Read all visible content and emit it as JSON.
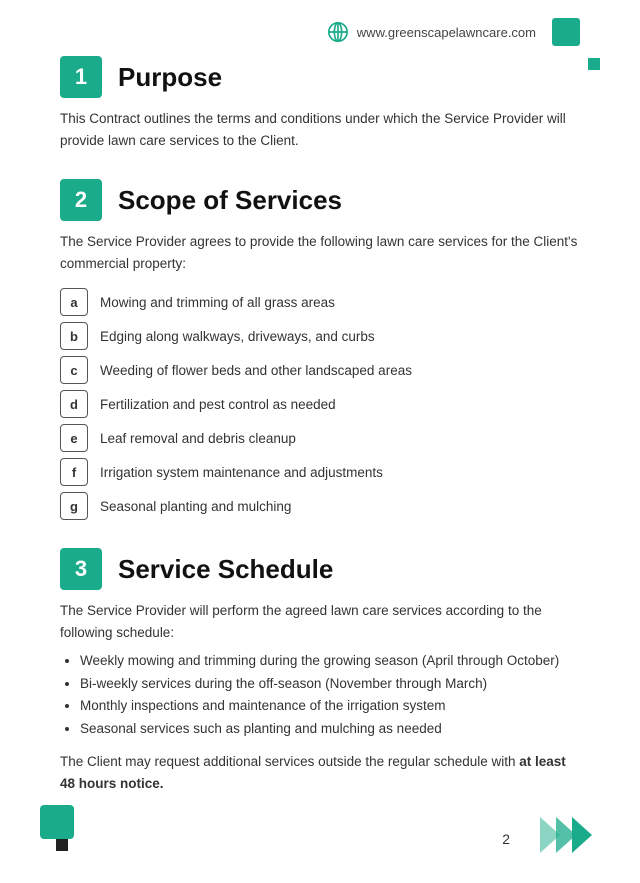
{
  "header": {
    "website": "www.greenscapelawncare.com"
  },
  "sections": [
    {
      "number": "1",
      "title": "Purpose",
      "body": "This Contract outlines the terms and conditions under which the Service Provider will provide lawn care services to the Client."
    },
    {
      "number": "2",
      "title": "Scope of Services",
      "intro": "The Service Provider agrees to provide the following lawn care services for the Client's commercial property:",
      "items": [
        {
          "label": "a",
          "text": "Mowing and trimming of all grass areas"
        },
        {
          "label": "b",
          "text": "Edging along walkways, driveways, and curbs"
        },
        {
          "label": "c",
          "text": "Weeding of flower beds and other landscaped areas"
        },
        {
          "label": "d",
          "text": "Fertilization and pest control as needed"
        },
        {
          "label": "e",
          "text": "Leaf removal and debris cleanup"
        },
        {
          "label": "f",
          "text": "Irrigation system maintenance and adjustments"
        },
        {
          "label": "g",
          "text": "Seasonal planting and mulching"
        }
      ]
    },
    {
      "number": "3",
      "title": "Service Schedule",
      "body": "The Service Provider will perform the agreed lawn care services according to the following schedule:",
      "bullets": [
        "Weekly mowing and trimming during the growing season (April through October)",
        "Bi-weekly services during the off-season (November through March)",
        "Monthly inspections and maintenance of the irrigation system",
        "Seasonal services such as planting and mulching as needed"
      ],
      "notice": "The Client may request additional services outside the regular schedule with ",
      "notice_bold": "at least 48 hours notice."
    }
  ],
  "page_number": "2"
}
